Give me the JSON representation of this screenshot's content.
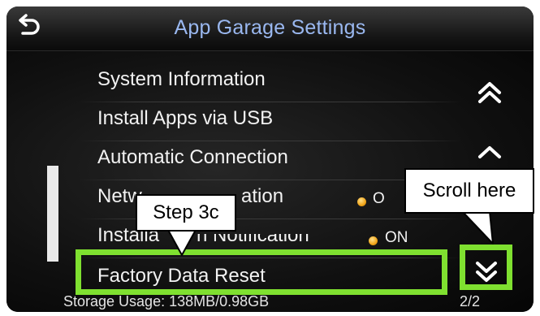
{
  "header": {
    "title": "App Garage Settings",
    "back_icon": "back-arrow-icon"
  },
  "menu": {
    "items": [
      {
        "label": "System Information"
      },
      {
        "label": "Install Apps via USB"
      },
      {
        "label": "Automatic Connection"
      },
      {
        "label": "Netw",
        "hidden_part": "ation",
        "status": "O"
      },
      {
        "label": "Installa",
        "hidden_part": "n Notification",
        "status": "ON"
      },
      {
        "label": "Factory Data Reset"
      }
    ]
  },
  "scroll": {
    "page_up_icon": "double-chevron-up-icon",
    "up_icon": "chevron-up-icon",
    "page_down_icon": "double-chevron-down-icon"
  },
  "footer": {
    "storage": "Storage Usage: 138MB/0.98GB",
    "page_indicator": "2/2"
  },
  "annotations": {
    "step_label": "Step 3c",
    "scroll_label": "Scroll here",
    "highlight_color": "#7fe030"
  },
  "colors": {
    "title": "#9ab8f0",
    "status_dot": "#f0a418"
  }
}
